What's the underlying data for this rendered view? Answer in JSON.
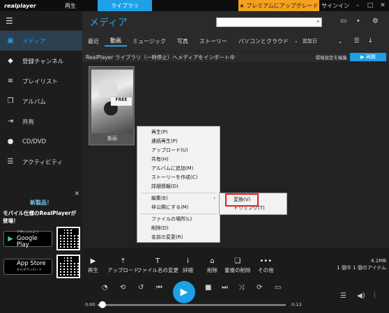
{
  "topbar": {
    "logo": "realplayer",
    "tab_play": "再生",
    "tab_library": "ライブラリ",
    "premium": "★ プレミアムにアップグレード",
    "signin": "サインイン"
  },
  "sidebar": {
    "items": [
      {
        "label": "メディア",
        "icon": "media-icon",
        "glyph": "▣"
      },
      {
        "label": "登録チャンネル",
        "icon": "channel-icon",
        "glyph": "◆"
      },
      {
        "label": "プレイリスト",
        "icon": "playlist-icon",
        "glyph": "≡"
      },
      {
        "label": "アルバム",
        "icon": "album-icon",
        "glyph": "❐"
      },
      {
        "label": "共有",
        "icon": "share-icon",
        "glyph": "⇥"
      },
      {
        "label": "CD/DVD",
        "icon": "disc-icon",
        "glyph": "●"
      },
      {
        "label": "アクティビティ",
        "icon": "activity-icon",
        "glyph": "☰"
      }
    ],
    "promo": {
      "title": "新製品！",
      "desc": "モバイル仕様のRealPlayerが登場！",
      "google_big": "Google Play",
      "google_small": "で手に入れよう",
      "apple_big": "App Store",
      "apple_small": "からダウンロード"
    },
    "status": "動画"
  },
  "main": {
    "title": "メディア",
    "nav": [
      "最近",
      "動画",
      "ミュージック",
      "写真",
      "ストーリー",
      "パソコンとクラウド"
    ],
    "sort": "追加日",
    "info": "RealPlayer ライブラリ（一時停止）へメディアをインポート中",
    "env_settings": "環境設定を編集",
    "resume": "▶ 再開",
    "thumb_label": "動画"
  },
  "context_menu": {
    "items": [
      "再生(P)",
      "連続再生(P)",
      "アップロード(U)",
      "共有(H)",
      "アルバムに追加(M)",
      "ストーリーを作成(C)",
      "詳細情報(D)",
      "編集(E)",
      "非公開にする(M)",
      "ファイルの場所(L)",
      "削除(D)",
      "名前の変更(R)"
    ],
    "submenu": [
      "変換(V)",
      "トリミング(T)"
    ]
  },
  "actions": {
    "items": [
      {
        "label": "再生",
        "icon": "play-icon",
        "glyph": "▶"
      },
      {
        "label": "アップロード",
        "icon": "upload-icon",
        "glyph": "⤒"
      },
      {
        "label": "ファイル名の変更",
        "icon": "rename-icon",
        "glyph": "T"
      },
      {
        "label": "詳細",
        "icon": "info-icon",
        "glyph": "i"
      },
      {
        "label": "削除",
        "icon": "trash-icon",
        "glyph": "🗑"
      },
      {
        "label": "重複の削除",
        "icon": "duplicate-icon",
        "glyph": "❏"
      },
      {
        "label": "その他",
        "icon": "more-icon",
        "glyph": "•••"
      }
    ],
    "size": "4.1MB",
    "count": "1 個中 1 個のアイテム"
  },
  "player": {
    "time_current": "0:00",
    "time_total": "0:13",
    "progress": 0
  }
}
